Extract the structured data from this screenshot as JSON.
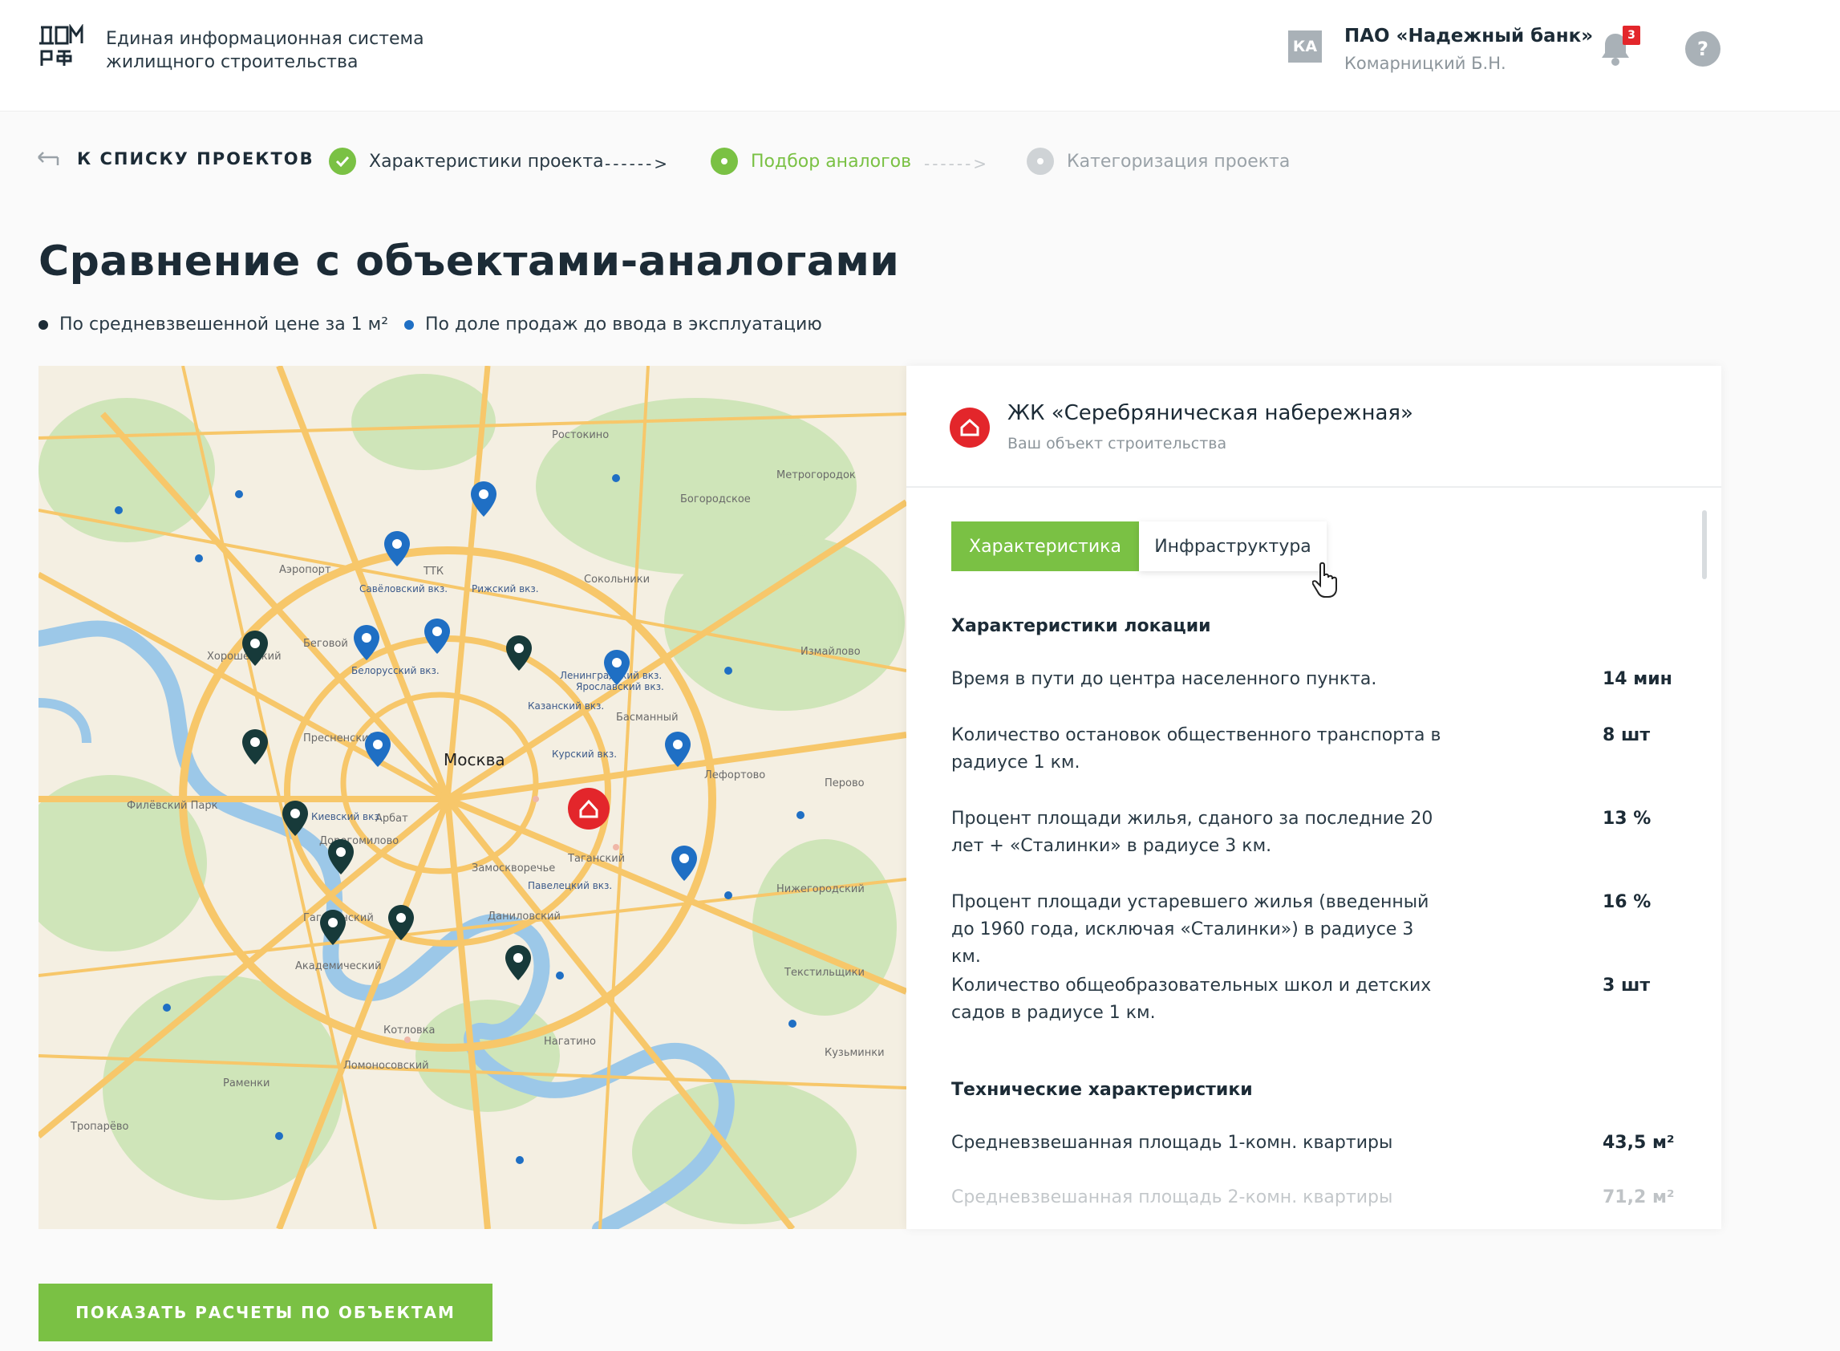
{
  "header": {
    "system_title": "Единая информационная система жилищного строительства",
    "user_initials": "КА",
    "user_org": "ПАО «Надежный банк»",
    "user_name": "Комарницкий Б.Н.",
    "notifications_count": "3",
    "help_label": "?"
  },
  "stepper": {
    "back_label": "К СПИСКУ ПРОЕКТОВ",
    "steps": [
      {
        "label": "Характеристики проекта",
        "state": "done"
      },
      {
        "label": "Подбор аналогов",
        "state": "active"
      },
      {
        "label": "Категоризация проекта",
        "state": "pending"
      }
    ]
  },
  "page": {
    "title": "Сравнение с объектами-аналогами",
    "legend": [
      {
        "label": "По средневзвешенной цене за 1 м²",
        "color": "#1c2b36"
      },
      {
        "label": "По доле продаж до ввода в эксплуатацию",
        "color": "#1f6fc4"
      }
    ]
  },
  "map": {
    "labels": [
      "Москва",
      "ТТК",
      "Арбат",
      "Таганский",
      "Пресненский",
      "Сокольники",
      "Аэропорт",
      "Хорошёвский",
      "Дорогомилово",
      "Филёвский Парк",
      "Замоскворечье",
      "Даниловский",
      "Академический",
      "Гагаринский",
      "Басманный",
      "Лефортово",
      "Перово",
      "Измайлово",
      "Нижегородский",
      "Текстильщики",
      "Кузьминки",
      "Нагатино",
      "Котловка",
      "Ломоносовский",
      "Раменки",
      "Тропарёво",
      "Метрогородок",
      "Богородское",
      "Ростокино",
      "Беговой",
      "Савёловский вкз.",
      "Рижский вкз.",
      "Белорусский вкз.",
      "Ленинградский вкз.",
      "Казанский вкз.",
      "Курский вкз.",
      "Павелецкий вкз.",
      "Киевский вкз.",
      "Ярославский вкз."
    ],
    "own_object_icon": "home-icon"
  },
  "panel": {
    "object_title": "ЖК «Серебряническая набережная»",
    "object_subtitle": "Ваш объект строительства",
    "tabs": [
      {
        "label": "Характеристика",
        "active": true
      },
      {
        "label": "Инфраструктура",
        "active": false
      }
    ],
    "sections": [
      {
        "title": "Характеристики локации",
        "rows": [
          {
            "label": "Время в пути до центра населенного пункта.",
            "value": "14 мин"
          },
          {
            "label": "Количество остановок общественного транспорта в радиусе 1 км.",
            "value": "8 шт"
          },
          {
            "label": "Процент площади жилья, сданого за последние  20 лет + «Сталинки» в радиусе 3 км.",
            "value": "13 %"
          },
          {
            "label": "Процент площади устаревшего жилья (введенный до 1960 года, исключая «Сталинки») в радиусе 3 км.",
            "value": "16 %"
          },
          {
            "label": "Количество общеобразовательных школ и детских садов в радиусе 1 км.",
            "value": "3 шт"
          }
        ]
      },
      {
        "title": "Технические характеристики",
        "rows": [
          {
            "label": "Средневзвешанная площадь 1-комн. квартиры",
            "value": "43,5 м²"
          },
          {
            "label": "Средневзвешанная площадь 2-комн. квартиры",
            "value": "71,2 м²"
          }
        ]
      }
    ]
  },
  "actions": {
    "show_calculations": "ПОКАЗАТЬ РАСЧЕТЫ ПО ОБЪЕКТАМ"
  },
  "colors": {
    "accent_green": "#7ac144",
    "brand_red": "#e3262b",
    "marker_blue": "#1f6fc4",
    "marker_dark": "#173a3a"
  }
}
